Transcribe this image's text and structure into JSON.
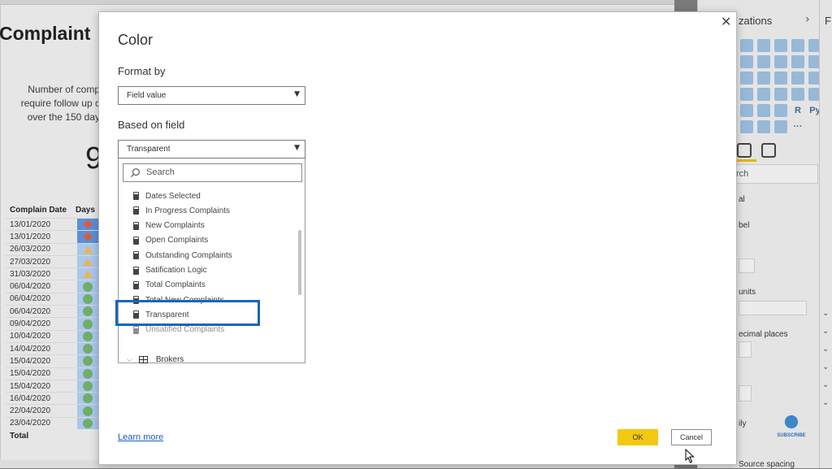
{
  "report": {
    "title": "Complaint",
    "description_lines": [
      "Number of comp",
      "require follow up c",
      "over the 150 day"
    ],
    "kpi_value": "9",
    "table": {
      "headers": [
        "Complain Date",
        "Days"
      ],
      "rows": [
        {
          "date": "13/01/2020",
          "indicator": "diamond"
        },
        {
          "date": "13/01/2020",
          "indicator": "diamond"
        },
        {
          "date": "26/03/2020",
          "indicator": "triangle"
        },
        {
          "date": "27/03/2020",
          "indicator": "triangle"
        },
        {
          "date": "31/03/2020",
          "indicator": "triangle"
        },
        {
          "date": "06/04/2020",
          "indicator": "circle"
        },
        {
          "date": "06/04/2020",
          "indicator": "circle"
        },
        {
          "date": "06/04/2020",
          "indicator": "circle"
        },
        {
          "date": "09/04/2020",
          "indicator": "circle"
        },
        {
          "date": "10/04/2020",
          "indicator": "circle"
        },
        {
          "date": "14/04/2020",
          "indicator": "circle"
        },
        {
          "date": "15/04/2020",
          "indicator": "circle"
        },
        {
          "date": "15/04/2020",
          "indicator": "circle"
        },
        {
          "date": "15/04/2020",
          "indicator": "circle"
        },
        {
          "date": "16/04/2020",
          "indicator": "circle"
        },
        {
          "date": "22/04/2020",
          "indicator": "circle"
        },
        {
          "date": "23/04/2020",
          "indicator": "circle"
        }
      ],
      "total_label": "Total"
    }
  },
  "visualizations_pane": {
    "title": "zations",
    "search_placeholder": "rch",
    "labels": [
      "al",
      "bel",
      "units",
      "ecimal places",
      "ily",
      "Source spacing"
    ],
    "icon_letters": [
      "R",
      "Py",
      "···"
    ]
  },
  "filters_pane": {
    "title": "F"
  },
  "dialog": {
    "title": "Color",
    "format_by_label": "Format by",
    "format_by_value": "Field value",
    "based_on_field_label": "Based on field",
    "based_on_field_value": "Transparent",
    "search_placeholder": "Search",
    "fields": [
      "Dates Selected",
      "In Progress Complaints",
      "New Complaints",
      "Open Complaints",
      "Outstanding Complaints",
      "Satification Logic",
      "Total Complaints",
      "Total New Complaints",
      "Transparent",
      "Unsatified Complaints"
    ],
    "group": "Brokers",
    "learn_more": "Learn more",
    "ok_label": "OK",
    "cancel_label": "Cancel"
  },
  "overlay": {
    "subscribe_label": "SUBSCRIBE"
  },
  "colors": {
    "accent_yellow": "#f2c811",
    "highlight_blue": "#1565c0",
    "link_blue": "#1f5fbf"
  }
}
